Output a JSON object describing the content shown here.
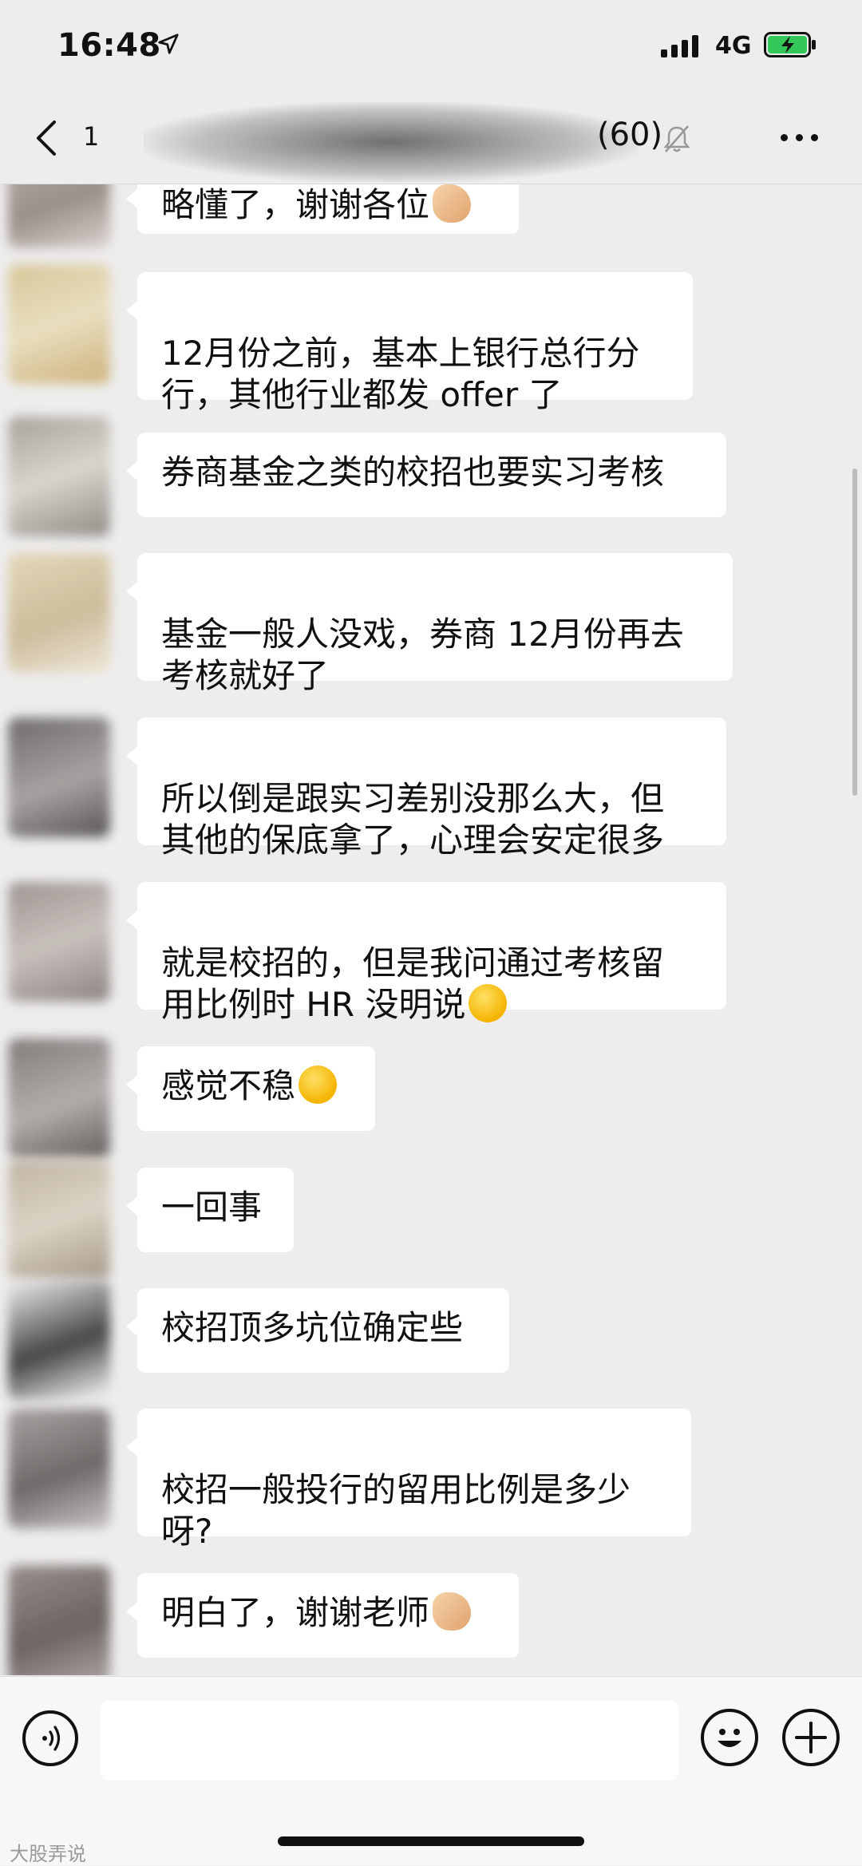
{
  "status_bar": {
    "time": "16:48",
    "network": "4G"
  },
  "nav": {
    "unread_count": "1",
    "title": "(60)"
  },
  "messages": [
    {
      "text": "略懂了，谢谢各位",
      "emoji": "hand"
    },
    {
      "text": "12月份之前，基本上银行总行分\n行，其他行业都发 offer 了"
    },
    {
      "text": "券商基金之类的校招也要实习考核"
    },
    {
      "text": "基金一般人没戏，券商 12月份再去\n考核就好了"
    },
    {
      "text": "所以倒是跟实习差别没那么大，但\n其他的保底拿了，心理会安定很多"
    },
    {
      "text": "就是校招的，但是我问通过考核留\n用比例时 HR 没明说",
      "emoji": "crying"
    },
    {
      "text": "感觉不稳",
      "emoji": "crying"
    },
    {
      "text": "一回事"
    },
    {
      "text": "校招顶多坑位确定些"
    },
    {
      "text": "校招一般投行的留用比例是多少\n呀?"
    },
    {
      "text": "明白了，谢谢老师",
      "emoji": "hand"
    }
  ],
  "input": {
    "placeholder": ""
  },
  "watermark": "大股弄说",
  "colors": {
    "background": "#ededed",
    "bubble": "#ffffff",
    "battery": "#34c759"
  }
}
